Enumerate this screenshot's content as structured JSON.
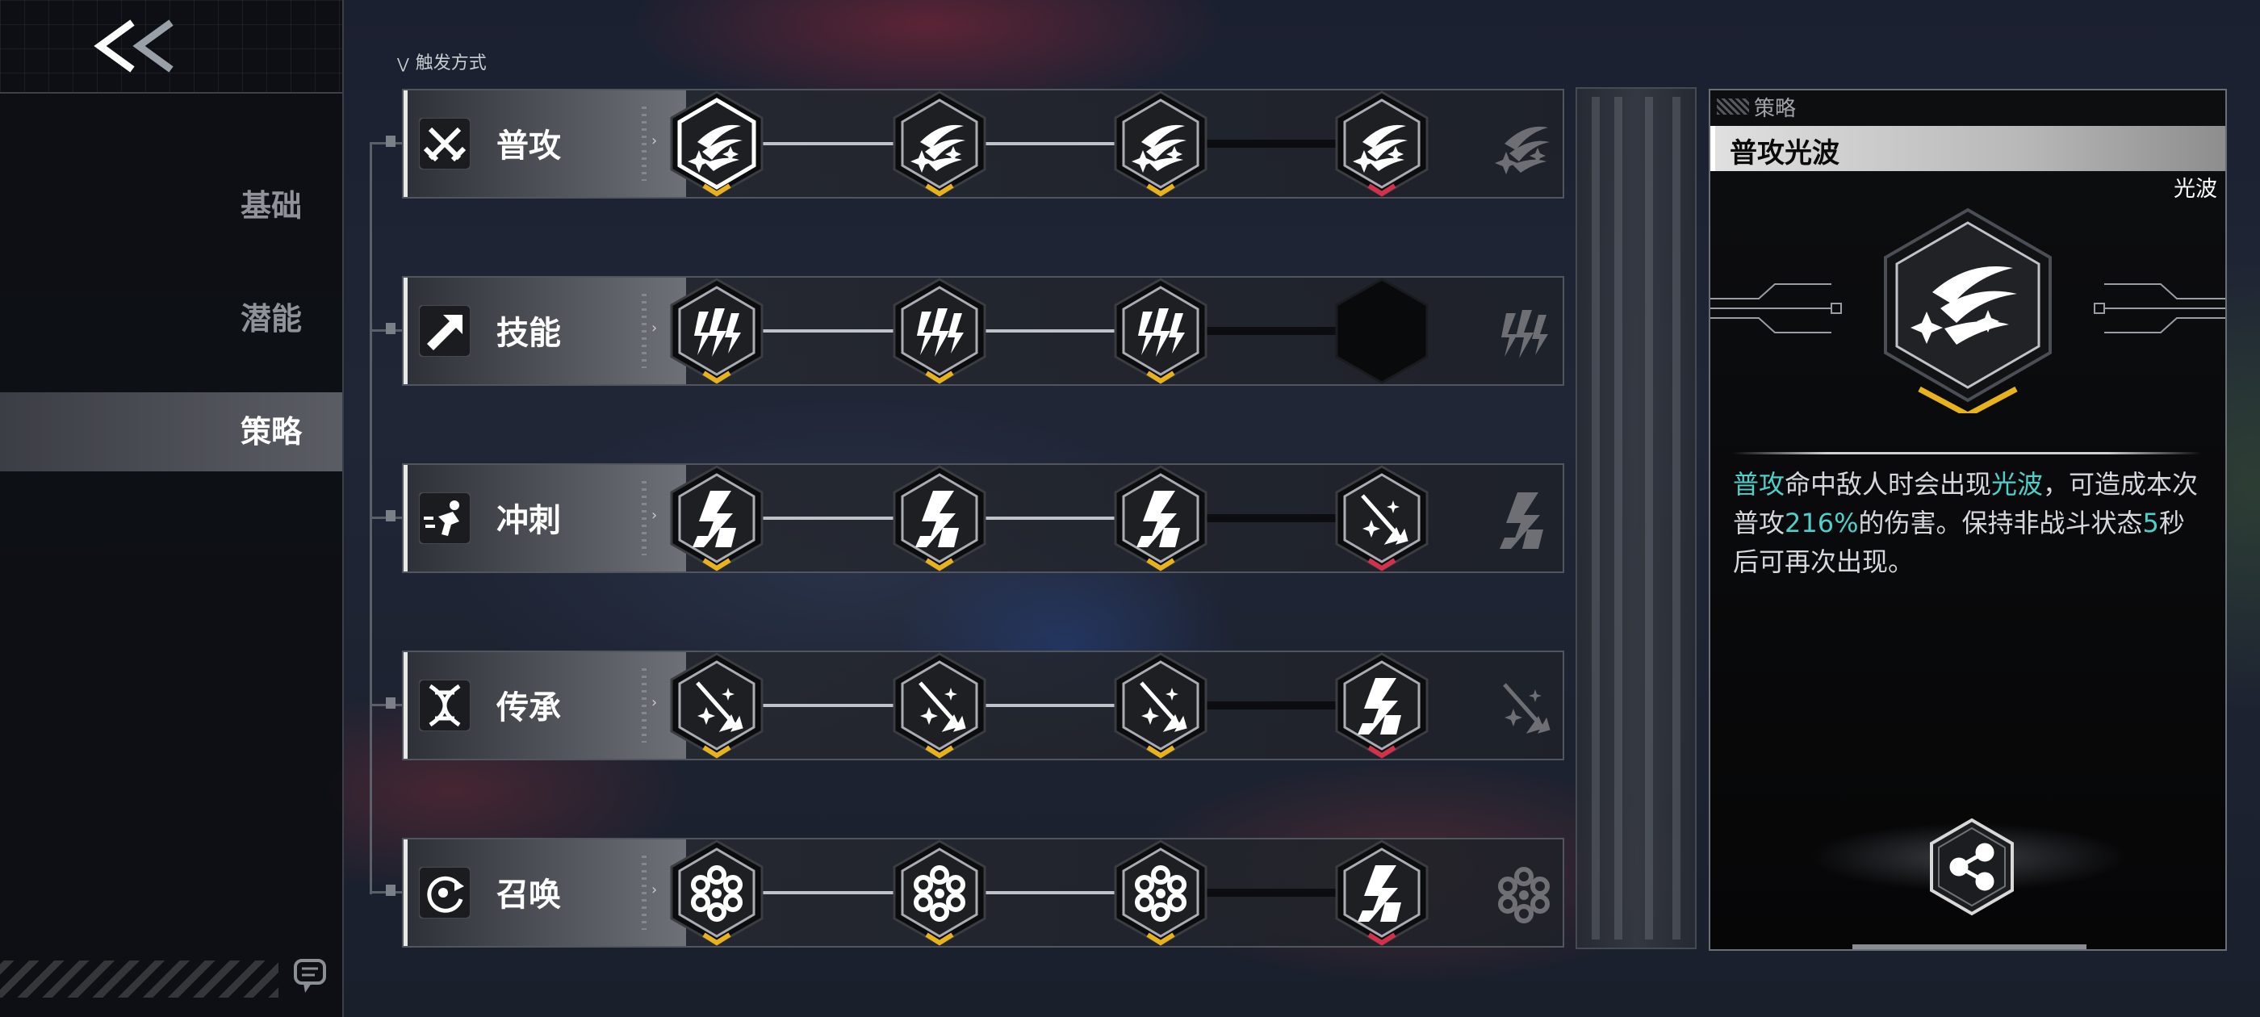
{
  "header": {
    "trigger_label": "触发方式"
  },
  "nav": {
    "items": [
      {
        "label": "基础",
        "active": false
      },
      {
        "label": "潜能",
        "active": false
      },
      {
        "label": "策略",
        "active": true
      }
    ]
  },
  "rows": [
    {
      "label": "普攻",
      "icon": "crossed-swords-icon",
      "nodes": [
        "comet-icon",
        "comet-icon",
        "comet-icon",
        "comet-icon"
      ],
      "markers": [
        "gold",
        "gold",
        "gold",
        "red"
      ],
      "selected": 0
    },
    {
      "label": "技能",
      "icon": "arrow-burst-icon",
      "nodes": [
        "claw-slash-icon",
        "claw-slash-icon",
        "claw-slash-icon",
        "empty-slot"
      ],
      "markers": [
        "gold",
        "gold",
        "gold",
        "none"
      ]
    },
    {
      "label": "冲刺",
      "icon": "dash-runner-icon",
      "nodes": [
        "lightning-dash-icon",
        "lightning-dash-icon",
        "lightning-dash-icon",
        "spear-burst-icon"
      ],
      "markers": [
        "gold",
        "gold",
        "gold",
        "red"
      ]
    },
    {
      "label": "传承",
      "icon": "dna-helix-icon",
      "nodes": [
        "spear-burst-icon",
        "spear-burst-icon",
        "spear-burst-icon",
        "lightning-dash-icon"
      ],
      "markers": [
        "gold",
        "gold",
        "gold",
        "red"
      ]
    },
    {
      "label": "召唤",
      "icon": "summon-cycle-icon",
      "nodes": [
        "flower-ring-icon",
        "flower-ring-icon",
        "flower-ring-icon",
        "lightning-dash-icon"
      ],
      "markers": [
        "gold",
        "gold",
        "gold",
        "red"
      ]
    }
  ],
  "detail": {
    "section": "策略",
    "title": "普攻光波",
    "type_tag": "光波",
    "icon": "comet-icon",
    "desc": {
      "p1_hl": "普攻",
      "p2": "命中敌人时会出现",
      "p3_hl": "光波",
      "p4": "，可造成本次普攻",
      "p5_hl": "216%",
      "p6": "的伤害。保持非战斗状态",
      "p7_hl": "5",
      "p8": "秒后可再次出现。"
    }
  },
  "colors": {
    "accent_teal": "#4ed0c8",
    "marker_gold": "#e8b21c",
    "marker_red": "#d3304a"
  }
}
